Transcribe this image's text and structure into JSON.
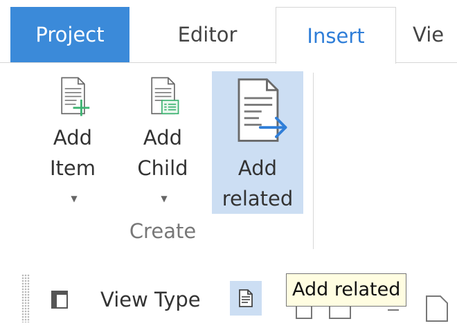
{
  "tabs": [
    {
      "label": "Project"
    },
    {
      "label": "Editor"
    },
    {
      "label": "Insert"
    },
    {
      "label": "Vie"
    }
  ],
  "ribbon": {
    "buttons": [
      {
        "line1": "Add",
        "line2": "Item",
        "icon": "add-item-icon",
        "has_dropdown": true
      },
      {
        "line1": "Add",
        "line2": "Child",
        "icon": "add-child-icon",
        "has_dropdown": true
      },
      {
        "line1": "Add",
        "line2": "related",
        "icon": "add-related-icon",
        "has_dropdown": false
      }
    ],
    "group_label": "Create"
  },
  "toolbar": {
    "view_type_label": "View Type"
  },
  "tooltip": {
    "text": "Add related"
  },
  "colors": {
    "accent_blue": "#3b8ad9",
    "active_tab_text": "#2f7ed8",
    "selected_bg": "#ccdef3",
    "plus_green": "#3cb371",
    "tooltip_bg": "#fffde1"
  }
}
